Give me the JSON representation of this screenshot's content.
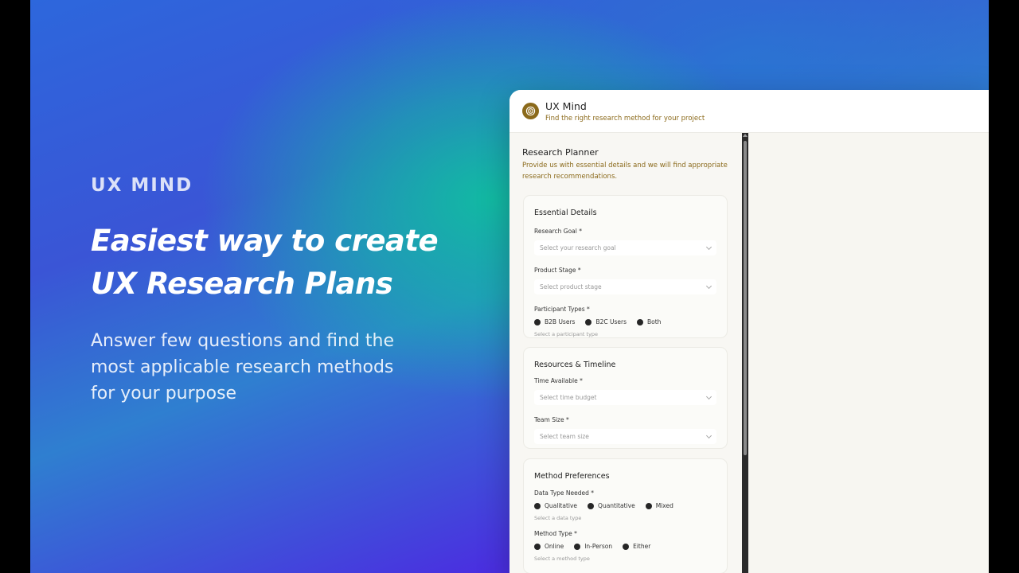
{
  "hero": {
    "brand": "UX MIND",
    "headline_line1": "Easiest way to create",
    "headline_line2": "UX Research Plans",
    "sub_line1": "Answer few questions and find the",
    "sub_line2": "most applicable research methods",
    "sub_line3": "for your purpose"
  },
  "app": {
    "title": "UX Mind",
    "subtitle": "Find the right research method for your project",
    "planner": {
      "title": "Research Planner",
      "description": "Provide us with essential details and we will find appropriate research recommendations."
    },
    "essential": {
      "title": "Essential Details",
      "goal_label": "Research Goal *",
      "goal_placeholder": "Select your research goal",
      "stage_label": "Product Stage *",
      "stage_placeholder": "Select product stage",
      "participants_label": "Participant Types *",
      "participants_options": [
        "B2B Users",
        "B2C Users",
        "Both"
      ],
      "participants_hint": "Select a participant type"
    },
    "resources": {
      "title": "Resources & Timeline",
      "time_label": "Time Available *",
      "time_placeholder": "Select time budget",
      "team_label": "Team Size *",
      "team_placeholder": "Select team size"
    },
    "methods": {
      "title": "Method Preferences",
      "data_label": "Data Type Needed *",
      "data_options": [
        "Qualitative",
        "Quantitative",
        "Mixed"
      ],
      "data_hint": "Select a data type",
      "type_label": "Method Type *",
      "type_options": [
        "Online",
        "In-Person",
        "Either"
      ],
      "type_hint": "Select a method type"
    }
  },
  "colors": {
    "accent": "#8b6a1b",
    "teal": "#10bea0",
    "violet": "#5a1fe8"
  },
  "icons": {
    "logo": "target-icon"
  }
}
